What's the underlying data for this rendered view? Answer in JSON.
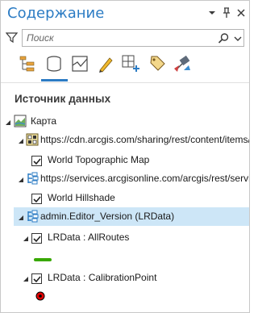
{
  "pane": {
    "title": "Содержание",
    "header_icons": [
      "dropdown-arrow-icon",
      "pin-icon",
      "close-icon"
    ]
  },
  "search": {
    "placeholder": "Поиск",
    "value": ""
  },
  "toolbar": {
    "tools": [
      {
        "name": "list-by-drawing-order-icon"
      },
      {
        "name": "list-by-data-source-icon",
        "active": true
      },
      {
        "name": "list-by-editing-icon"
      },
      {
        "name": "list-by-snapping-icon"
      },
      {
        "name": "list-by-selection-icon"
      },
      {
        "name": "list-by-labeling-icon"
      },
      {
        "name": "list-by-perspective-imagery-icon"
      }
    ]
  },
  "section_title": "Источник данных",
  "tree": {
    "map": {
      "label": "Карта",
      "icon": "map-icon"
    },
    "source1": {
      "label": "https://cdn.arcgis.com/sharing/rest/content/items/...",
      "icon": "tile-service-icon"
    },
    "layer1": {
      "label": "World Topographic Map",
      "checked": true
    },
    "source2": {
      "label": "https://services.arcgisonline.com/arcgis/rest/services/...",
      "icon": "map-service-icon"
    },
    "layer2": {
      "label": "World Hillshade",
      "checked": true
    },
    "source3": {
      "label": "admin.Editor_Version (LRData)",
      "icon": "database-connection-icon",
      "selected": true
    },
    "layer3": {
      "label": "LRData : AllRoutes",
      "checked": true,
      "symbol_color": "#38a800"
    },
    "layer4": {
      "label": "LRData : CalibrationPoint",
      "checked": true,
      "symbol_color": "#e60000"
    }
  },
  "colors": {
    "accent": "#2c7cc4",
    "selection": "#cde6f7",
    "route": "#38a800",
    "point": "#e60000"
  }
}
